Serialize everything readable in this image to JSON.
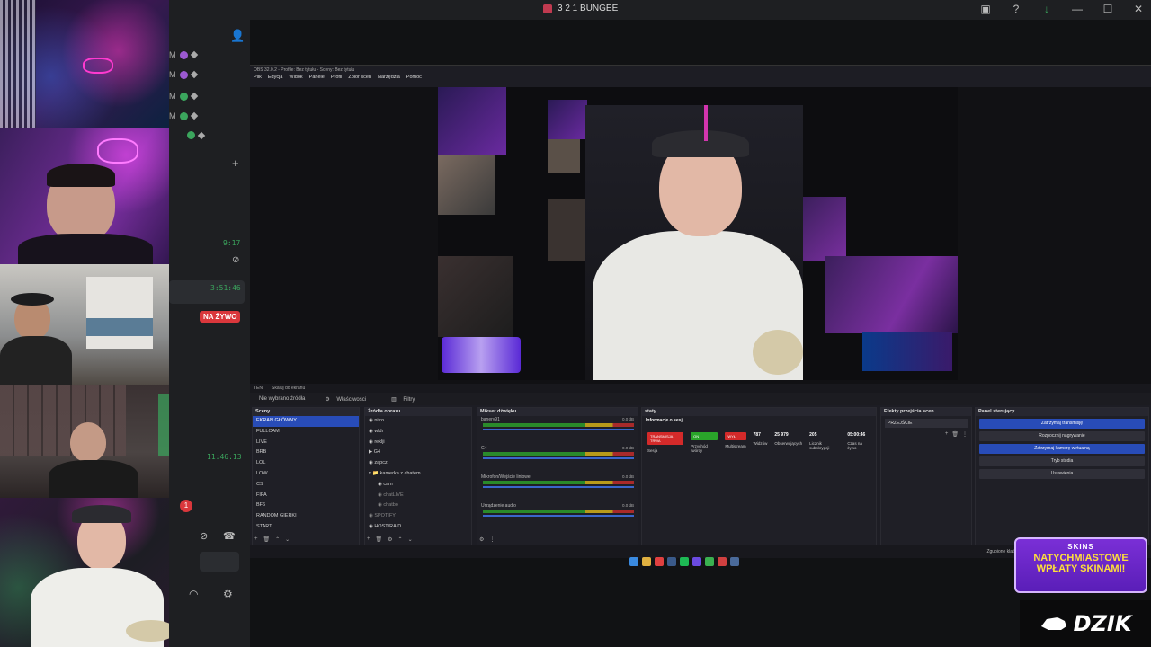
{
  "window": {
    "title": "3 2 1 BUNGEE"
  },
  "topbar_icons": [
    "screen-share-icon",
    "help-icon",
    "download-icon"
  ],
  "side": {
    "members_prefix": "M",
    "timestamps": [
      "9:17",
      "3:51:46",
      "11:46:13"
    ],
    "live_badge": "NA ŻYWO",
    "notification_count": "1"
  },
  "obs": {
    "title": "OBS 32.0.2 - Profile: Bez tytułu - Sceny: Bez tytułu",
    "menu": [
      "Plik",
      "Edycja",
      "Widok",
      "Panele",
      "Profil",
      "Zbiór scen",
      "Narzędzia",
      "Pomoc"
    ],
    "preview_bar": [
      "TEN",
      "Skaluj do ekranu"
    ],
    "context": {
      "no_source": "Nie wybrano źródła",
      "properties": "Właściwości",
      "filters": "Filtry"
    },
    "scenes": {
      "title": "Sceny",
      "items": [
        "EKRAN GŁÓWNY",
        "FULLCAM",
        "LIVE",
        "BRB",
        "LOL",
        "LOW",
        "CS",
        "FIFA",
        "BF6",
        "RANDOM GIERKI",
        "START"
      ],
      "selected": 0
    },
    "sources": {
      "title": "Źródła obrazu",
      "items": [
        "nitro",
        "wldr",
        "reklji",
        "G4",
        "zapcz",
        "kamerka z chatem",
        "cam",
        "chatLIVE",
        "chatbo",
        "SPOTIFY",
        "HOST/RAID"
      ]
    },
    "mixer": {
      "title": "Mikser dźwięku",
      "channels": [
        {
          "name": "banery91",
          "db": "0.0 dB"
        },
        {
          "name": "G4",
          "db": "0.0 dB"
        },
        {
          "name": "Mikrofon/Wejście liniowe",
          "db": "0.0 dB"
        },
        {
          "name": "Urządzenie audio",
          "db": "0.0 dB"
        }
      ]
    },
    "stats": {
      "title": "staty",
      "subtitle": "Informacje o sesji",
      "badges": [
        {
          "label": "TRANSMISJA TRWA",
          "color": "#d42a2a"
        },
        {
          "label": "ON",
          "color": "#2aa52a"
        },
        {
          "label": "WYŁ",
          "color": "#d42a2a"
        }
      ],
      "session_label": "Sesja",
      "income_label": "Przychód twórcy",
      "multistream_label": "Multistream",
      "cells": [
        {
          "value": "787",
          "label": "Widzów"
        },
        {
          "value": "25 979",
          "label": "Obserwujących"
        },
        {
          "value": "205",
          "label": "Licznik subskrypcji"
        },
        {
          "value": "05:00:46",
          "label": "Czas na żywo"
        }
      ]
    },
    "transitions": {
      "title": "Efekty przejścia scen",
      "value": "PRZEJŚCIE"
    },
    "controls": {
      "title": "Panel sterujący",
      "buttons": [
        "Zatrzymaj transmisję",
        "Rozpocznij nagrywanie",
        "Zatrzymaj kamerę wirtualną",
        "Tryb studia",
        "Ustawienia"
      ]
    },
    "status": "Zgubione klatki 284 (0.0%)     8720 kb/s"
  },
  "promo": {
    "brand": "SKINS",
    "line1": "NATYCHMIASTOWE",
    "line2": "WPŁATY SKINAMI!"
  },
  "dzik": {
    "logo": "DZIK"
  }
}
